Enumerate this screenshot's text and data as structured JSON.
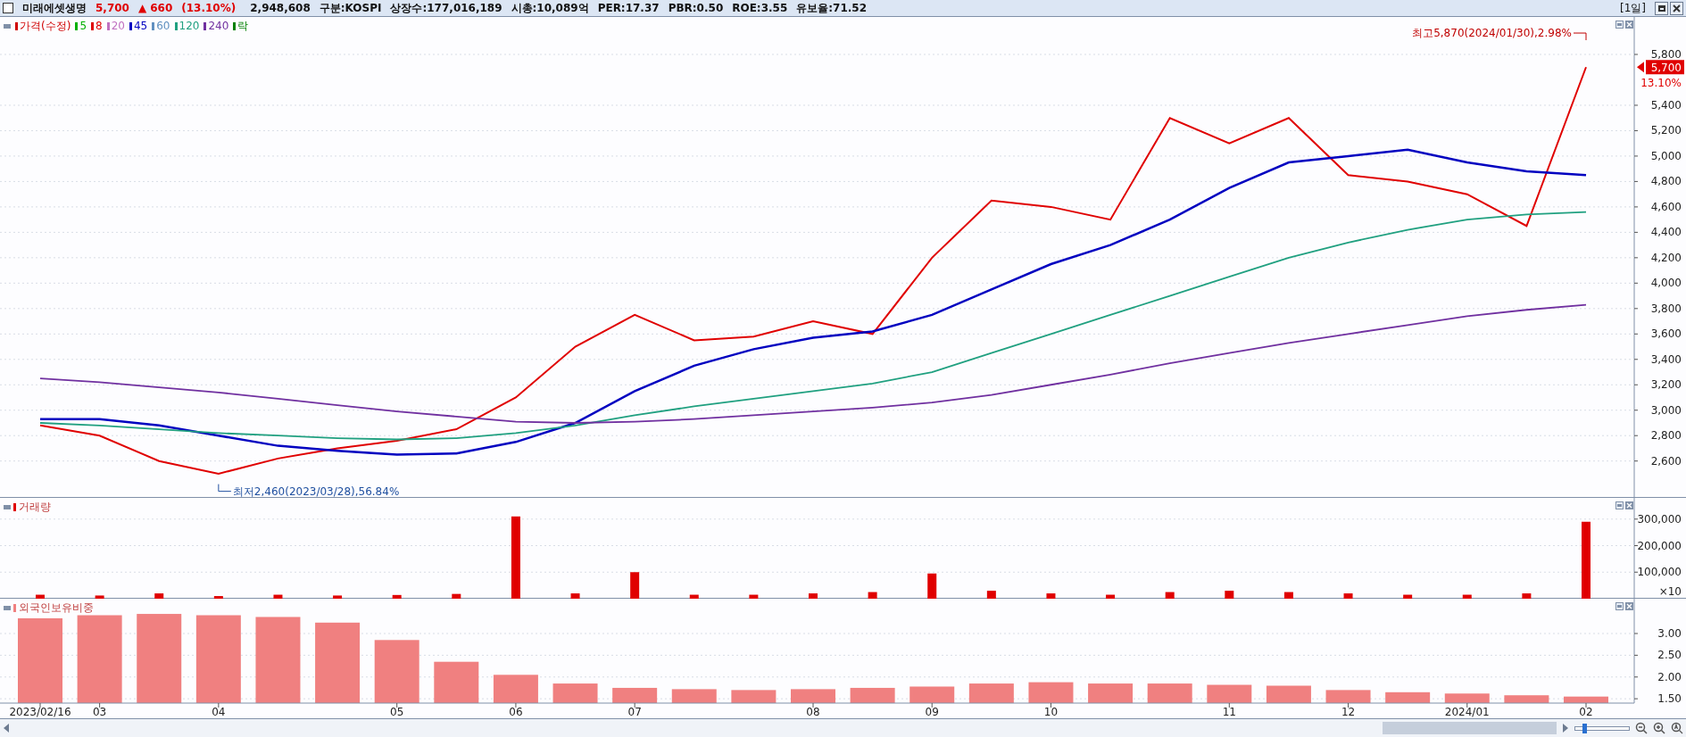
{
  "header": {
    "name": "미래에셋생명",
    "price": "5,700",
    "change_sign": "▲",
    "change": "660",
    "change_rate": "(13.10%)",
    "volume": "2,948,608",
    "fields": [
      "구분:KOSPI",
      "상장수:177,016,189",
      "시총:10,089억",
      "PER:17.37",
      "PBR:0.50",
      "ROE:3.55",
      "유보율:71.52"
    ],
    "period": "[1일]",
    "checked": false
  },
  "zoom_slider": {
    "level": 0.15
  },
  "price_panel": {
    "legend": [
      {
        "label": "가격(수정)",
        "color": "#d00000"
      },
      {
        "label": "5",
        "color": "#00b000"
      },
      {
        "label": "8",
        "color": "#e00000"
      },
      {
        "label": "20",
        "color": "#c070c0"
      },
      {
        "label": "45",
        "color": "#0000c0"
      },
      {
        "label": "60",
        "color": "#6090c0"
      },
      {
        "label": "120",
        "color": "#20a080"
      },
      {
        "label": "240",
        "color": "#7030a0"
      },
      {
        "label": "락",
        "color": "#008000"
      }
    ],
    "last_price": "5,700",
    "last_change": "13.10%",
    "chart_data": {
      "type": "line",
      "ylim": [
        2310,
        6095
      ],
      "grid": true,
      "yticks": [
        {
          "value": 2600,
          "label": "2,600"
        },
        {
          "value": 2800,
          "label": "2,800"
        },
        {
          "value": 3000,
          "label": "3,000"
        },
        {
          "value": 3200,
          "label": "3,200"
        },
        {
          "value": 3400,
          "label": "3,400"
        },
        {
          "value": 3600,
          "label": "3,600"
        },
        {
          "value": 3800,
          "label": "3,800"
        },
        {
          "value": 4000,
          "label": "4,000"
        },
        {
          "value": 4200,
          "label": "4,200"
        },
        {
          "value": 4400,
          "label": "4,400"
        },
        {
          "value": 4600,
          "label": "4,600"
        },
        {
          "value": 4800,
          "label": "4,800"
        },
        {
          "value": 5000,
          "label": "5,000"
        },
        {
          "value": 5200,
          "label": "5,200"
        },
        {
          "value": 5400,
          "label": "5,400"
        },
        {
          "value": 5800,
          "label": "5,800"
        }
      ],
      "series": [
        {
          "color": "#e00000",
          "values": [
            2880,
            2800,
            2600,
            2500,
            2620,
            2700,
            2760,
            2850,
            3100,
            3500,
            3750,
            3550,
            3580,
            3700,
            3600,
            4200,
            4650,
            4600,
            4500,
            5300,
            5100,
            5300,
            4850,
            4800,
            4700,
            4450,
            5700
          ]
        },
        {
          "color": "#0000c0",
          "values": [
            2930,
            2930,
            2880,
            2800,
            2720,
            2680,
            2650,
            2660,
            2750,
            2900,
            3150,
            3350,
            3480,
            3570,
            3620,
            3750,
            3950,
            4150,
            4300,
            4500,
            4750,
            4950,
            5000,
            5050,
            4950,
            4880,
            4850
          ]
        },
        {
          "color": "#20a080",
          "values": [
            2900,
            2880,
            2850,
            2820,
            2800,
            2780,
            2770,
            2780,
            2820,
            2880,
            2960,
            3030,
            3090,
            3150,
            3210,
            3300,
            3450,
            3600,
            3750,
            3900,
            4050,
            4200,
            4320,
            4420,
            4500,
            4540,
            4560
          ]
        },
        {
          "color": "#7030a0",
          "values": [
            3250,
            3220,
            3180,
            3140,
            3090,
            3040,
            2990,
            2950,
            2910,
            2900,
            2910,
            2930,
            2960,
            2990,
            3020,
            3060,
            3120,
            3200,
            3280,
            3370,
            3450,
            3530,
            3600,
            3670,
            3740,
            3790,
            3830
          ]
        }
      ],
      "annotations": [
        "최고5,870(2024/01/30),2.98%",
        "최저2,460(2023/03/28),56.84%"
      ]
    }
  },
  "volume_panel": {
    "title": "거래량",
    "unit": "×10",
    "chart_data": {
      "type": "bar",
      "ylim": [
        0,
        380000
      ],
      "grid": true,
      "yticks": [
        {
          "value": 100000,
          "label": "100,000"
        },
        {
          "value": 200000,
          "label": "200,000"
        },
        {
          "value": 300000,
          "label": "300,000"
        }
      ],
      "series": [
        {
          "color": "#e00000",
          "values": [
            15000,
            12000,
            20000,
            10000,
            15000,
            12000,
            14000,
            18000,
            310000,
            20000,
            100000,
            15000,
            15000,
            20000,
            25000,
            95000,
            30000,
            20000,
            15000,
            25000,
            30000,
            25000,
            20000,
            15000,
            15000,
            20000,
            290000
          ]
        }
      ]
    }
  },
  "foreign_panel": {
    "title": "외국인보유비중",
    "chart_data": {
      "type": "bar",
      "ylim": [
        1.4,
        3.8
      ],
      "grid": true,
      "yticks": [
        {
          "value": 1.5,
          "label": "1.50"
        },
        {
          "value": 2,
          "label": "2.00"
        },
        {
          "value": 2.5,
          "label": "2.50"
        },
        {
          "value": 3,
          "label": "3.00"
        }
      ],
      "categories": [
        "2023/02/16",
        "03",
        null,
        "04",
        null,
        null,
        "05",
        null,
        "06",
        null,
        "07",
        null,
        null,
        "08",
        null,
        "09",
        null,
        "10",
        null,
        null,
        "11",
        null,
        "12",
        null,
        "2024/01",
        null,
        "02"
      ],
      "series": [
        {
          "color": "#f08080",
          "values": [
            3.35,
            3.42,
            3.45,
            3.42,
            3.38,
            3.25,
            2.85,
            2.35,
            2.05,
            1.85,
            1.75,
            1.72,
            1.7,
            1.72,
            1.75,
            1.78,
            1.85,
            1.88,
            1.85,
            1.85,
            1.82,
            1.8,
            1.7,
            1.65,
            1.62,
            1.58,
            1.55
          ]
        }
      ]
    }
  }
}
